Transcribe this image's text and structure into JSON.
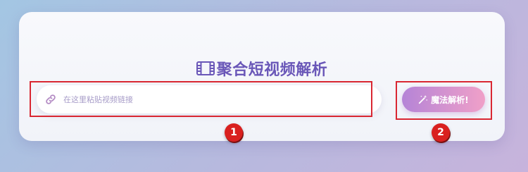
{
  "app": {
    "title": "聚合短视频解析",
    "title_icon": "film-icon"
  },
  "search": {
    "placeholder": "在这里粘贴视频链接",
    "value": "",
    "icon": "link-icon"
  },
  "action": {
    "label": "魔法解析!",
    "icon": "magic-wand-icon"
  },
  "annotations": {
    "markers": [
      "1",
      "2"
    ],
    "color": "#d9201f"
  },
  "colors": {
    "title": "#6a57b8",
    "button_gradient_start": "#b584d7",
    "button_gradient_end": "#f0a0c8"
  }
}
